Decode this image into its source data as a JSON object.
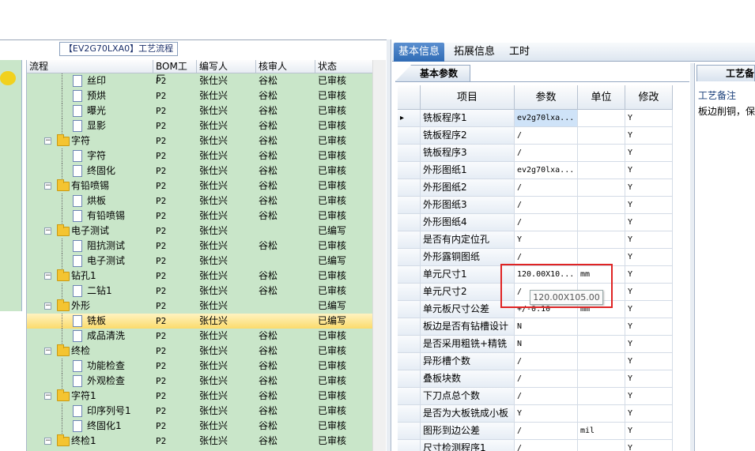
{
  "left_panel": {
    "title": "【EV2G70LXA0】工艺流程",
    "columns": [
      "流程",
      "BOM工厂",
      "编写人",
      "核审人",
      "状态"
    ],
    "rows": [
      {
        "level": 2,
        "type": "doc",
        "name": "丝印",
        "bom": "P2",
        "writer": "张仕兴",
        "reviewer": "谷松",
        "status": "已审核"
      },
      {
        "level": 2,
        "type": "doc",
        "name": "预烘",
        "bom": "P2",
        "writer": "张仕兴",
        "reviewer": "谷松",
        "status": "已审核"
      },
      {
        "level": 2,
        "type": "doc",
        "name": "曝光",
        "bom": "P2",
        "writer": "张仕兴",
        "reviewer": "谷松",
        "status": "已审核"
      },
      {
        "level": 2,
        "type": "doc",
        "name": "显影",
        "bom": "P2",
        "writer": "张仕兴",
        "reviewer": "谷松",
        "status": "已审核"
      },
      {
        "level": 1,
        "type": "folder",
        "name": "字符",
        "bom": "P2",
        "writer": "张仕兴",
        "reviewer": "谷松",
        "status": "已审核"
      },
      {
        "level": 2,
        "type": "doc",
        "name": "字符",
        "bom": "P2",
        "writer": "张仕兴",
        "reviewer": "谷松",
        "status": "已审核"
      },
      {
        "level": 2,
        "type": "doc",
        "name": "终固化",
        "bom": "P2",
        "writer": "张仕兴",
        "reviewer": "谷松",
        "status": "已审核"
      },
      {
        "level": 1,
        "type": "folder",
        "name": "有铅喷锡",
        "bom": "P2",
        "writer": "张仕兴",
        "reviewer": "谷松",
        "status": "已审核"
      },
      {
        "level": 2,
        "type": "doc",
        "name": "烘板",
        "bom": "P2",
        "writer": "张仕兴",
        "reviewer": "谷松",
        "status": "已审核"
      },
      {
        "level": 2,
        "type": "doc",
        "name": "有铅喷锡",
        "bom": "P2",
        "writer": "张仕兴",
        "reviewer": "谷松",
        "status": "已审核"
      },
      {
        "level": 1,
        "type": "folder",
        "name": "电子测试",
        "bom": "P2",
        "writer": "张仕兴",
        "reviewer": "",
        "status": "已编写"
      },
      {
        "level": 2,
        "type": "doc",
        "name": "阻抗测试",
        "bom": "P2",
        "writer": "张仕兴",
        "reviewer": "谷松",
        "status": "已审核"
      },
      {
        "level": 2,
        "type": "doc",
        "name": "电子测试",
        "bom": "P2",
        "writer": "张仕兴",
        "reviewer": "",
        "status": "已编写"
      },
      {
        "level": 1,
        "type": "folder",
        "name": "钻孔1",
        "bom": "P2",
        "writer": "张仕兴",
        "reviewer": "谷松",
        "status": "已审核"
      },
      {
        "level": 2,
        "type": "doc",
        "name": "二钻1",
        "bom": "P2",
        "writer": "张仕兴",
        "reviewer": "谷松",
        "status": "已审核"
      },
      {
        "level": 1,
        "type": "folder",
        "name": "外形",
        "bom": "P2",
        "writer": "张仕兴",
        "reviewer": "",
        "status": "已编写"
      },
      {
        "level": 2,
        "type": "doc",
        "name": "铣板",
        "bom": "P2",
        "writer": "张仕兴",
        "reviewer": "",
        "status": "已编写",
        "selected": true
      },
      {
        "level": 2,
        "type": "doc",
        "name": "成品清洗",
        "bom": "P2",
        "writer": "张仕兴",
        "reviewer": "谷松",
        "status": "已审核"
      },
      {
        "level": 1,
        "type": "folder",
        "name": "终检",
        "bom": "P2",
        "writer": "张仕兴",
        "reviewer": "谷松",
        "status": "已审核"
      },
      {
        "level": 2,
        "type": "doc",
        "name": "功能检查",
        "bom": "P2",
        "writer": "张仕兴",
        "reviewer": "谷松",
        "status": "已审核"
      },
      {
        "level": 2,
        "type": "doc",
        "name": "外观检查",
        "bom": "P2",
        "writer": "张仕兴",
        "reviewer": "谷松",
        "status": "已审核"
      },
      {
        "level": 1,
        "type": "folder",
        "name": "字符1",
        "bom": "P2",
        "writer": "张仕兴",
        "reviewer": "谷松",
        "status": "已审核"
      },
      {
        "level": 2,
        "type": "doc",
        "name": "印序列号1",
        "bom": "P2",
        "writer": "张仕兴",
        "reviewer": "谷松",
        "status": "已审核"
      },
      {
        "level": 2,
        "type": "doc",
        "name": "终固化1",
        "bom": "P2",
        "writer": "张仕兴",
        "reviewer": "谷松",
        "status": "已审核"
      },
      {
        "level": 1,
        "type": "folder",
        "name": "终检1",
        "bom": "P2",
        "writer": "张仕兴",
        "reviewer": "谷松",
        "status": "已审核"
      }
    ]
  },
  "right_panel": {
    "tabs": [
      "基本信息",
      "拓展信息",
      "工时"
    ],
    "active_tab": "基本信息",
    "subtab": "基本参数",
    "columns": [
      "项目",
      "参数",
      "单位",
      "修改"
    ],
    "rows": [
      {
        "item": "铣板程序1",
        "param": "ev2g70lxa...",
        "unit": "",
        "mod": "Y",
        "current": true
      },
      {
        "item": "铣板程序2",
        "param": "/",
        "unit": "",
        "mod": "Y"
      },
      {
        "item": "铣板程序3",
        "param": "/",
        "unit": "",
        "mod": "Y"
      },
      {
        "item": "外形图纸1",
        "param": "ev2g70lxa...",
        "unit": "",
        "mod": "Y"
      },
      {
        "item": "外形图纸2",
        "param": "/",
        "unit": "",
        "mod": "Y"
      },
      {
        "item": "外形图纸3",
        "param": "/",
        "unit": "",
        "mod": "Y"
      },
      {
        "item": "外形图纸4",
        "param": "/",
        "unit": "",
        "mod": "Y"
      },
      {
        "item": "是否有内定位孔",
        "param": "Y",
        "unit": "",
        "mod": "Y"
      },
      {
        "item": "外形露铜图纸",
        "param": "/",
        "unit": "",
        "mod": "Y"
      },
      {
        "item": "单元尺寸1",
        "param": "120.00X10...",
        "unit": "mm",
        "mod": "Y"
      },
      {
        "item": "单元尺寸2",
        "param": "/",
        "unit": "",
        "mod": "Y"
      },
      {
        "item": "单元板尺寸公差",
        "param": "+/-0.10",
        "unit": "mm",
        "mod": "Y"
      },
      {
        "item": "板边是否有钻槽设计",
        "param": "N",
        "unit": "",
        "mod": "Y"
      },
      {
        "item": "是否采用粗铣+精铣",
        "param": "N",
        "unit": "",
        "mod": "Y"
      },
      {
        "item": "异形槽个数",
        "param": "/",
        "unit": "",
        "mod": "Y"
      },
      {
        "item": "叠板块数",
        "param": "/",
        "unit": "",
        "mod": "Y"
      },
      {
        "item": "下刀点总个数",
        "param": "/",
        "unit": "",
        "mod": "Y"
      },
      {
        "item": "是否为大板铣成小板",
        "param": "Y",
        "unit": "",
        "mod": "Y"
      },
      {
        "item": "图形到边公差",
        "param": "/",
        "unit": "mil",
        "mod": "Y"
      },
      {
        "item": "尺寸检测程序1",
        "param": "/",
        "unit": "",
        "mod": "Y"
      }
    ],
    "tooltip": "120.00X105.00"
  },
  "side_panel": {
    "tab": "工艺备注",
    "header": "工艺备注",
    "text": "板边削铜，保"
  },
  "colors": {
    "tree_bg": "#c9e6c9",
    "selected_row": "#fbdb6c",
    "highlight_box": "#e02424",
    "active_tab": "#2f6bb5"
  }
}
